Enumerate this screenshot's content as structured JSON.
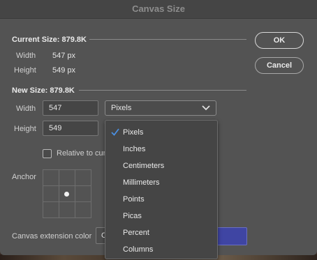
{
  "dialog": {
    "title": "Canvas Size",
    "current_size": {
      "heading": "Current Size: 879.8K",
      "width_label": "Width",
      "width_value": "547 px",
      "height_label": "Height",
      "height_value": "549 px"
    },
    "new_size": {
      "heading": "New Size: 879.8K",
      "width_label": "Width",
      "width_value": "547",
      "height_label": "Height",
      "height_value": "549",
      "unit_selected": "Pixels"
    },
    "relative_label": "Relative to cur",
    "relative_checked": false,
    "anchor_label": "Anchor",
    "anchor_selected": "center",
    "extension_label": "Canvas extension color",
    "extension_select_partial": "O",
    "extension_color": "#3f45a3",
    "buttons": {
      "ok": "OK",
      "cancel": "Cancel"
    }
  },
  "unit_menu": {
    "items": [
      "Pixels",
      "Inches",
      "Centimeters",
      "Millimeters",
      "Points",
      "Picas",
      "Percent",
      "Columns"
    ],
    "selected": "Pixels"
  },
  "colors": {
    "dialog_bg": "#535353",
    "check_accent": "#4a90e2"
  }
}
